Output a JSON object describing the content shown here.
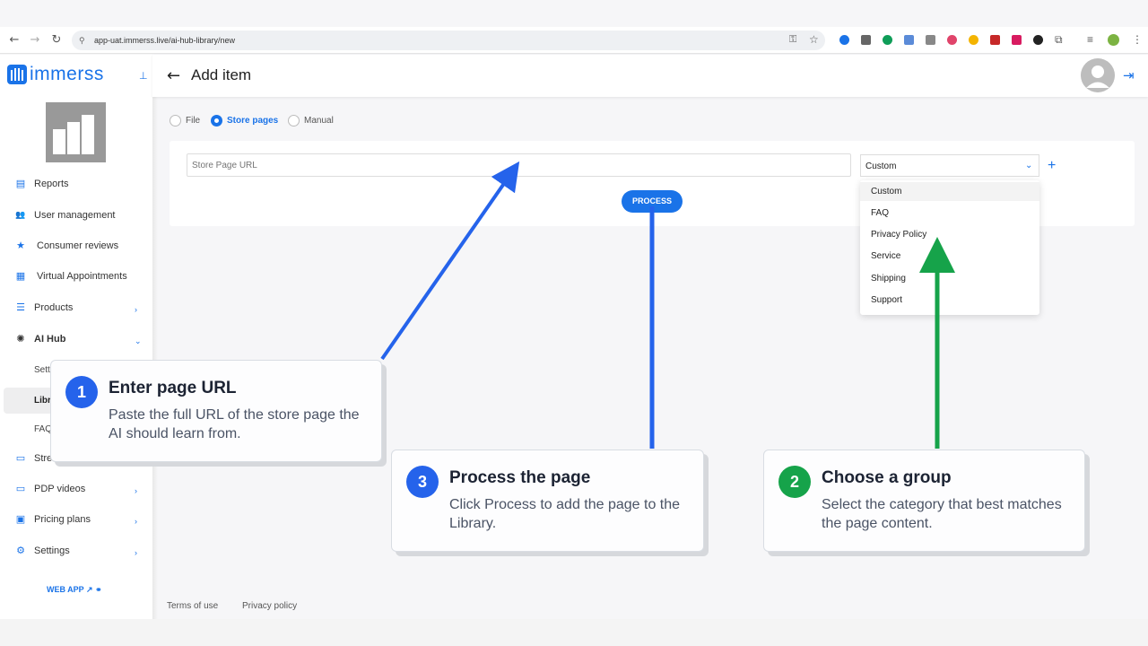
{
  "browser": {
    "url": "app-uat.immerss.live/ai-hub-library/new",
    "nav": {
      "back": "←",
      "forward": "→",
      "reload": "↻"
    }
  },
  "app": {
    "logo": "immerss"
  },
  "sidebar": {
    "items": [
      {
        "label": "Reports",
        "icon": "reports-icon",
        "glyph": "▤"
      },
      {
        "label": "User management",
        "icon": "users-icon",
        "glyph": "👥"
      },
      {
        "label": "Consumer reviews",
        "icon": "star-icon",
        "glyph": "★"
      },
      {
        "label": "Virtual Appointments",
        "icon": "calendar-icon",
        "glyph": "▦"
      },
      {
        "label": "Products",
        "icon": "list-icon",
        "glyph": "☰"
      },
      {
        "label": "AI Hub",
        "icon": "ai-hub-icon",
        "glyph": "✺"
      },
      {
        "label": "PDP videos",
        "icon": "video-icon",
        "glyph": "▭"
      },
      {
        "label": "Pricing plans",
        "icon": "pricing-icon",
        "glyph": "▣"
      },
      {
        "label": "Settings",
        "icon": "gear-icon",
        "glyph": "⚙"
      }
    ],
    "sub_items": [
      "Sett",
      "Libr",
      "FAQ",
      "Stre"
    ],
    "web_app": "WEB APP"
  },
  "header": {
    "title": "Add item"
  },
  "source_options": [
    "File",
    "Store pages",
    "Manual"
  ],
  "selected_source": "Store pages",
  "form": {
    "url_placeholder": "Store Page URL",
    "group_selected": "Custom",
    "process_label": "PROCESS"
  },
  "dropdown": {
    "options": [
      "Custom",
      "FAQ",
      "Privacy Policy",
      "Service",
      "Shipping",
      "Support"
    ]
  },
  "footer": {
    "terms": "Terms of use",
    "privacy": "Privacy policy"
  },
  "callouts": [
    {
      "number": "1",
      "title": "Enter page URL",
      "body": "Paste the full URL of the store page the AI should learn from.",
      "color": "#2563eb"
    },
    {
      "number": "3",
      "title": "Process the page",
      "body": "Click Process to add the page to the Library.",
      "color": "#2563eb"
    },
    {
      "number": "2",
      "title": "Choose a group",
      "body": "Select the category that best matches the page content.",
      "color": "#16a34a"
    }
  ],
  "colors": {
    "accent": "#1a73e8",
    "blue_arrow": "#2563eb",
    "green_arrow": "#16a34a"
  }
}
